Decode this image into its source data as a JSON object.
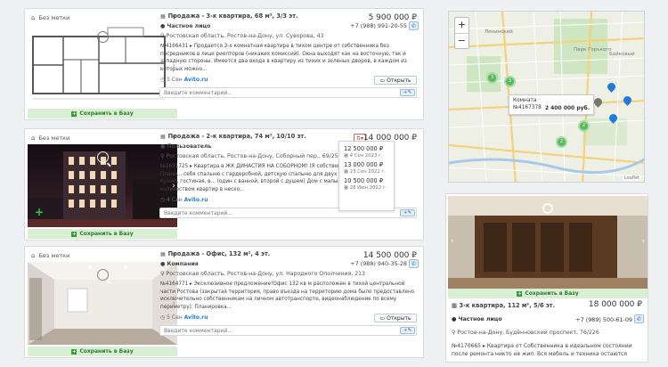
{
  "listings": [
    {
      "tag_label": "Без метки",
      "title": "Продажа - 3-к квартира, 68 м², 3/3 эт.",
      "price": "5 900 000 ₽",
      "agent": "Частное лицо",
      "phone": "+7 (988) 991-20-55",
      "address": "Ростовская область, Ростов-на-Дону, ул. Суворова, 43",
      "description": "№4166431 ▸ Продается 3-х комнатная квартира в тихом центре от собственника без посредников в лице риелторов (никаких комиссий). Окна выходят как на восточную, так и западную стороны. Имеется два входа в квартиру из тихих и зеленых дворов, в каждом из которых можно...",
      "age": "5 Сен",
      "source": "Avito.ru",
      "open_label": "Открыть",
      "comment_placeholder": "Введите комментарий...",
      "save_label": "Сохранить в Базу"
    },
    {
      "tag_label": "Без метки",
      "title": "Продажа - 2-к квартира, 74 м², 10/10 эт.",
      "price": "14 000 000 ₽",
      "agent": "Пользователь",
      "phone": "",
      "address": "Ростовская область, Ростов-на-Дону, Соборный пер., 69/253",
      "description": "№2691725 ▸ Квартира в ЖК ДИНАСТИЯ НА СОБОРНОМ! (Я собственник!) Плани... себя спальню с гардеробной, детскую спальню для двух детей, кухню, гостиная, в... (один с ванной, второй с душем) Дом с малым количеством квартир в неско...",
      "age": "4 Сен",
      "source": "Avito.ru",
      "open_label": "",
      "comment_placeholder": "Введите комментарий...",
      "save_label": "Сохранить в Базу"
    },
    {
      "tag_label": "Без метки",
      "title": "Продажа - Офис, 132 м², 4 эт.",
      "price": "14 500 000 ₽",
      "agent": "Компания",
      "phone": "+7 (988) 940-35-28",
      "address": "Ростовская область, Ростов-на-Дону, ул. Народного Ополчения, 213",
      "description": "№4164771 ▸ Эксклюзивное предложение!Офис 132 кв м расположен в тихой центральной части Ростова (закрытая территория, право въезда на территорию дома было предоставлено исключительно собственникам на личном автотранспорте, видеонаблюдение по всему периметру). Планировка...",
      "age": "5 Сен",
      "source": "Avito.ru",
      "open_label": "Открыть",
      "comment_placeholder": "Введите комментарий...",
      "save_label": "Сохранить в Базу"
    }
  ],
  "price_history": [
    {
      "price": "12 500 000 ₽",
      "date": "4 Сен 2023 г."
    },
    {
      "price": "13 000 000 ₽",
      "date": "23 Сен 2022 г."
    },
    {
      "price": "10 500 000 ₽",
      "date": "28 Июн 2022 г."
    }
  ],
  "map": {
    "zoom_in": "+",
    "zoom_out": "−",
    "popup_title": "Комната",
    "popup_id": "№4167378",
    "popup_price": "2 400 000 руб.",
    "label_park": "Парк Горького",
    "label_dist": "Ленинский",
    "label_baikal": "Байковый",
    "clusters": [
      "3",
      "3",
      "2",
      "2"
    ],
    "attribution": "Leaflet"
  },
  "side_listing": {
    "save_label": "Сохранить в Базу",
    "title": "3-к квартира, 112 м², 5/6 эт.",
    "price": "18 000 000 ₽",
    "agent": "Частное лицо",
    "phone": "+7 (989) 500-61-09",
    "address": "Ростов-на-Дону, Будённовский проспект, 76/226",
    "description": "№4170665 ▸ Квартира от Собственника в идеальном состоянии после ремонта никто не жил. Вся мебель и техника остаются"
  }
}
